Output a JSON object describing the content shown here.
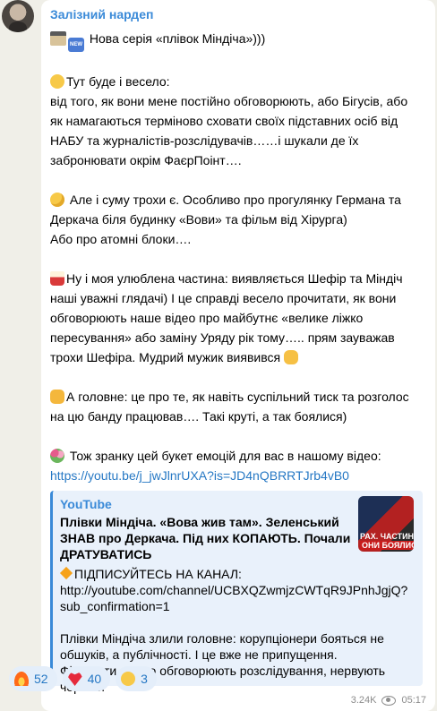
{
  "channel": {
    "name": "Залізний нардеп"
  },
  "message": {
    "line1": "Нова серія «плівок Міндіча»)))",
    "p1": [
      "Тут буде і весело:",
      "від того, як вони мене постійно обговорюють, або Бігусів, або",
      "як намагаються терміново сховати своїх підставних осіб від",
      "НАБУ та журналістів-розслідувачів……і шукали де їх",
      "забронювати окрім ФаєрПоінт…."
    ],
    "p2": [
      "Але і суму трохи є. Особливо про прогулянку Германа та",
      "Деркача біля будинку «Вови» та фільм від Хірурга)",
      "Або про атомні блоки…."
    ],
    "p3": [
      "Ну і моя улюблена частина: виявляється Шефір та Міндіч",
      "наші уважні глядачі) І це справді весело прочитати, як вони",
      "обговорюють наше відео про майбутнє «велике ліжко",
      "пересування» або заміну Уряду рік тому….. прям зауважав",
      "трохи Шефіра. Мудрий мужик виявився"
    ],
    "p4": [
      "А головне: це про те, як навіть суспільний тиск та розголос",
      "на цю банду працював…. Такі круті, а так боялися)"
    ],
    "p5": "Тож зранку цей букет емоцій для вас в нашому відео:",
    "link": "https://youtu.be/j_jwJlnrUXA?is=JD4nQBRRTJrb4vB0"
  },
  "preview": {
    "site": "YouTube",
    "title_lines": [
      "Плівки Міндіча. «Вова жив там». Зеленський",
      "ЗНАВ про Деркача. Під них КОПАЮТЬ. Почали",
      "ДРАТУВАТИСЬ"
    ],
    "desc_lines": [
      "ПІДПИСУЙТЕСЬ НА КАНАЛ:",
      "http://youtube.com/channel/UCBXQZwmjzCWTqR9JPnhJgjQ?",
      "sub_confirmation=1",
      "",
      "Плівки Міндіча злили головне: корупціонери бояться не",
      "обшуків, а публічності. І це вже не припущення.",
      "Фігуранти прямо обговорюють розслідування, нервують",
      "через…"
    ],
    "thumb_text_1": "РАХ. ЧАСТИНА",
    "thumb_text_2": "ОНИ БОЯЛИС"
  },
  "reactions": [
    {
      "emoji": "fire",
      "count": "52"
    },
    {
      "emoji": "heart",
      "count": "40"
    },
    {
      "emoji": "tongue-face",
      "count": "3"
    }
  ],
  "meta": {
    "views": "3.24K",
    "time": "05:17"
  }
}
